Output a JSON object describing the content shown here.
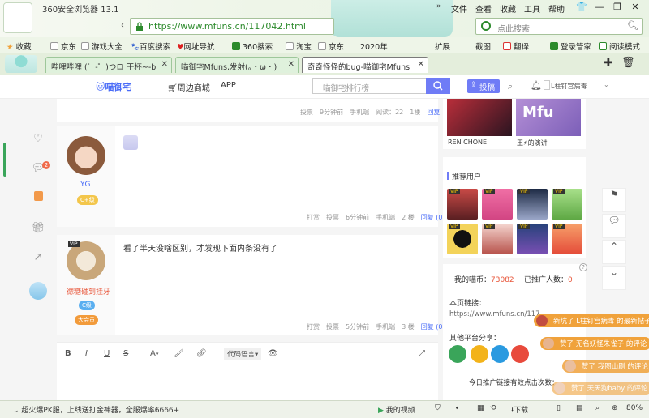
{
  "browser": {
    "app_title": "360安全浏览器 13.1",
    "address": "https://www.mfuns.cn/117042.html",
    "search_placeholder": "点此搜索",
    "menu": [
      "文件",
      "查看",
      "收藏",
      "工具",
      "帮助"
    ],
    "bookmarks": [
      "收藏",
      "京东",
      "游戏大全",
      "百度搜索",
      "网址导航",
      "360搜索",
      "淘宝",
      "京东",
      "2020年",
      "扩展",
      "截图",
      "翻译",
      "登录管家",
      "阅读模式"
    ],
    "tabs": [
      {
        "label": "哔哩哔哩 (゜-゜)つロ 干杯~-b"
      },
      {
        "label": "喵御宅Mfuns,发射(。・ω・)"
      },
      {
        "label": "奇奇怪怪的bug-喵御宅Mfuns"
      }
    ],
    "icons": [
      "shirt-icon",
      "minimize-icon",
      "restore-icon",
      "close-icon",
      "add-tab-icon",
      "trash-icon"
    ]
  },
  "site": {
    "logo": "喵御宅",
    "nav": [
      "周边商城",
      "APP"
    ],
    "search_placeholder": "喵御宅排行榜",
    "post_button": "投稿",
    "user_name": "L柱钉宫病毒"
  },
  "sidebar_left": {
    "comment_badge": "2"
  },
  "posts": [
    {
      "meta": [
        "投票",
        "9分钟前",
        "手机端",
        "阅读：22",
        "1楼",
        "回复"
      ]
    },
    {
      "author": "YG",
      "level": "C+级",
      "text": "",
      "meta": [
        "打赏",
        "投票",
        "6分钟前",
        "手机端",
        "2 楼",
        "回复 (0)"
      ]
    },
    {
      "author": "德糖碰到挂牙",
      "level": "C级",
      "level2": "大会员",
      "text": "看了半天没啥区别，才发现下面内条没有了",
      "meta": [
        "打赏",
        "投票",
        "5分钟前",
        "手机端",
        "3 楼",
        "回复 (0)"
      ]
    }
  ],
  "editor": {
    "tools": [
      "B",
      "I",
      "U",
      "S",
      "A",
      "代码语言"
    ]
  },
  "right": {
    "top_labels": [
      "REN CHONE",
      "王⚡的演讲"
    ],
    "recommend_title": "推荐用户",
    "user_tags": [
      "VIP",
      "VIP",
      "VIP",
      "VIP",
      "VIP",
      "VIP",
      "VIP",
      "VIP"
    ],
    "coins_label": "我的喵币：",
    "coins_value": "73082",
    "promote_label": "已推广人数：",
    "promote_value": "0",
    "page_link_label": "本页链接：",
    "page_link_value": "https://www.mfuns.cn/117...",
    "share_label": "其他平台分享：",
    "today_label": "今日推广链接有效点击次数：",
    "help_icon": "?"
  },
  "notifications": [
    {
      "text": "新坑了 L柱钉宫病毒 的最新帖子"
    },
    {
      "text": "赞了 无名妖怪朱雀子 的评论"
    },
    {
      "text": "赞了 我图山刷 的评论"
    },
    {
      "text": "赞了 天天狗baby 的评论"
    }
  ],
  "statusbar": {
    "promo": "超火爆PK服，上线送打金神器，全服爆率6666+",
    "video": "我的视频",
    "download": "下载",
    "zoom": "80%"
  },
  "colors": {
    "accent": "#6f7cf6",
    "green": "#3aa55a",
    "notif": "#f0a23b"
  }
}
